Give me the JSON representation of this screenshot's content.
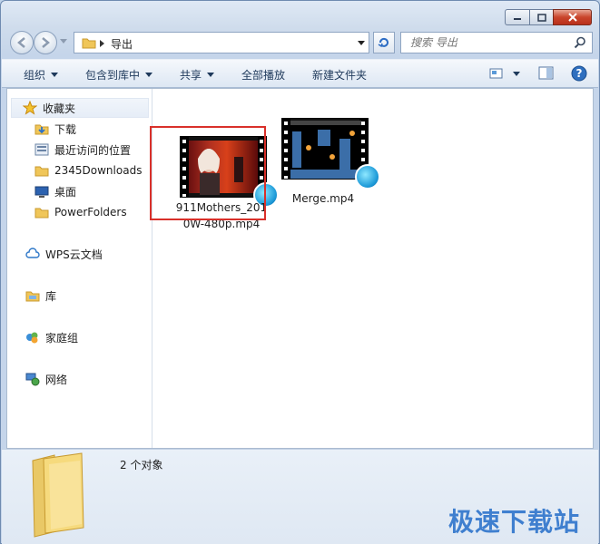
{
  "window": {
    "caption": {
      "minimize": "minimize",
      "maximize": "maximize",
      "close": "close"
    }
  },
  "address": {
    "crumb": "导出",
    "search_placeholder": "搜索 导出"
  },
  "toolbar": {
    "organize": "组织",
    "include_in_library": "包含到库中",
    "share": "共享",
    "play_all": "全部播放",
    "new_folder": "新建文件夹"
  },
  "nav": {
    "favorites": "收藏夹",
    "favorites_items": [
      {
        "label": "下载",
        "icon": "downloads-folder-icon"
      },
      {
        "label": "最近访问的位置",
        "icon": "recent-places-icon"
      },
      {
        "label": "2345Downloads",
        "icon": "folder-icon"
      },
      {
        "label": "桌面",
        "icon": "desktop-icon"
      },
      {
        "label": "PowerFolders",
        "icon": "folder-icon"
      }
    ],
    "wps_cloud": "WPS云文档",
    "libraries": "库",
    "homegroup": "家庭组",
    "network": "网络"
  },
  "files": [
    {
      "name_line1": "911Mothers_201",
      "name_line2": "0W-480p.mp4",
      "selected": true
    },
    {
      "name_line1": "Merge.mp4",
      "name_line2": "",
      "selected": false
    }
  ],
  "status": {
    "count": "2 个对象"
  },
  "watermark": "极速下载站",
  "colors": {
    "selection_outline": "#d9302a",
    "watermark": "#3f7fcf",
    "toolbar_text": "#1e395b"
  }
}
